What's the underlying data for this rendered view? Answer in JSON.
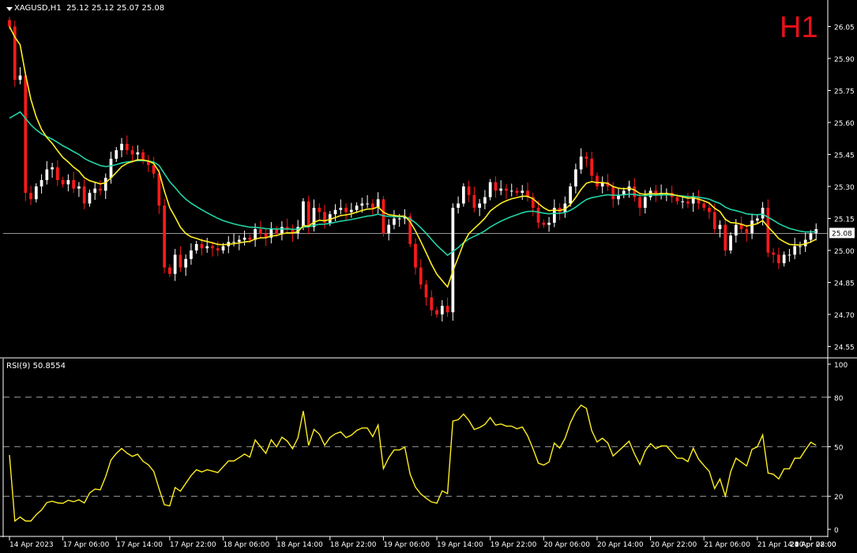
{
  "header": {
    "symbol": "XAGUSD,H1",
    "ohlc": "25.12 25.12 25.07 25.08",
    "timeframe_badge": "H1"
  },
  "indicator": {
    "label": "RSI(9) 50.8554"
  },
  "colors": {
    "background": "#000000",
    "bull_candle": "#ffffff",
    "bear_candle": "#ff1a1a",
    "fast_ma": "#ffee22",
    "slow_ma": "#22d4a6",
    "rsi_line": "#ffee22",
    "axis": "#ffffff",
    "price_line": "#c8c8c8",
    "price_tag_bg": "#ffffff"
  },
  "chart_data": [
    {
      "type": "candlestick",
      "symbol": "XAGUSD",
      "timeframe": "H1",
      "ylim": [
        24.5,
        26.1
      ],
      "y_ticks": [
        "26.05",
        "25.90",
        "25.75",
        "25.60",
        "25.45",
        "25.30",
        "25.15",
        "25.00",
        "24.85",
        "24.70",
        "24.55"
      ],
      "y_tick_values": [
        26.05,
        25.9,
        25.75,
        25.6,
        25.45,
        25.3,
        25.15,
        25.0,
        24.85,
        24.7,
        24.55
      ],
      "x_tick_labels": [
        "14 Apr 2023",
        "17 Apr 06:00",
        "17 Apr 14:00",
        "17 Apr 22:00",
        "18 Apr 06:00",
        "18 Apr 14:00",
        "18 Apr 22:00",
        "19 Apr 06:00",
        "19 Apr 14:00",
        "19 Apr 22:00",
        "20 Apr 06:00",
        "20 Apr 14:00",
        "20 Apr 22:00",
        "21 Apr 06:00",
        "21 Apr 14:00",
        "21 Apr 22:00",
        "24 Apr 08:00"
      ],
      "x_tick_index": [
        0,
        10,
        20,
        30,
        40,
        50,
        60,
        70,
        80,
        90,
        100,
        110,
        120,
        130,
        140,
        150,
        160
      ],
      "current_price": 25.08,
      "current_price_label": "25.08",
      "close": [
        26.05,
        25.8,
        25.82,
        25.27,
        25.24,
        25.3,
        25.33,
        25.38,
        25.39,
        25.33,
        25.31,
        25.33,
        25.29,
        25.3,
        25.22,
        25.27,
        25.29,
        25.28,
        25.34,
        25.43,
        25.47,
        25.5,
        25.47,
        25.45,
        25.46,
        25.42,
        25.4,
        25.36,
        25.21,
        24.92,
        24.89,
        24.98,
        24.92,
        24.96,
        25.0,
        25.03,
        25.01,
        25.02,
        25.01,
        25.0,
        25.02,
        25.04,
        25.04,
        25.05,
        25.06,
        25.05,
        25.1,
        25.08,
        25.06,
        25.1,
        25.08,
        25.11,
        25.1,
        25.08,
        25.11,
        25.23,
        25.11,
        25.2,
        25.18,
        25.13,
        25.17,
        25.19,
        25.2,
        25.18,
        25.19,
        25.21,
        25.22,
        25.22,
        25.2,
        25.24,
        25.08,
        25.12,
        25.15,
        25.15,
        25.16,
        25.03,
        24.92,
        24.84,
        24.78,
        24.72,
        24.7,
        24.74,
        24.71,
        25.2,
        25.22,
        25.3,
        25.26,
        25.2,
        25.22,
        25.25,
        25.32,
        25.28,
        25.29,
        25.28,
        25.28,
        25.27,
        25.28,
        25.25,
        25.2,
        25.13,
        25.12,
        25.13,
        25.2,
        25.18,
        25.22,
        25.3,
        25.38,
        25.44,
        25.43,
        25.35,
        25.3,
        25.32,
        25.3,
        25.24,
        25.26,
        25.28,
        25.3,
        25.25,
        25.2,
        25.25,
        25.28,
        25.26,
        25.27,
        25.27,
        25.25,
        25.23,
        25.23,
        25.22,
        25.25,
        25.22,
        25.2,
        25.18,
        25.1,
        25.12,
        25.0,
        25.07,
        25.12,
        25.1,
        25.08,
        25.14,
        25.15,
        25.2,
        24.99,
        24.98,
        24.94,
        24.98,
        24.98,
        25.02,
        25.02,
        25.05,
        25.08,
        25.1
      ],
      "chart_type_note": "OHLC candles with two moving averages"
    },
    {
      "type": "line",
      "name": "RSI(9)",
      "ylim": [
        0,
        100
      ],
      "y_ticks": [
        "100",
        "80",
        "50",
        "20",
        "0"
      ],
      "y_tick_values": [
        100,
        80,
        50,
        20,
        0
      ],
      "levels": [
        80,
        50,
        20
      ],
      "last_value": 50.8554
    }
  ]
}
